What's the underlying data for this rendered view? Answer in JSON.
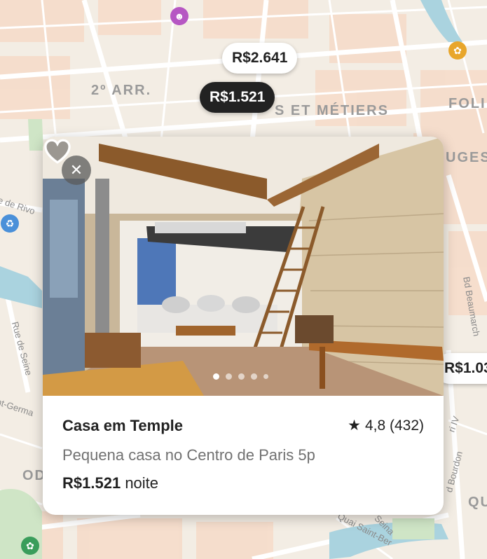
{
  "map": {
    "labels": {
      "arrondissement": "2º ARR.",
      "arts_metiers": "S ET MÉTIERS",
      "folie": "FOLI",
      "uges": "UGES",
      "od": "OD",
      "qu": "QU"
    },
    "streets": {
      "rue_de_rivoli": "e de Rivo",
      "rue_de_seine": "Rue de Seine",
      "bd_beaumarchais": "Bd Beaumarch",
      "rue_bourdon": "d Bourdon",
      "saint_germain": "nt-Germa",
      "quai_saint_bernard": "Quai Saint-Ber",
      "seine": "Seina",
      "henri_iv": "ri IV"
    },
    "pins": {
      "pin_top": "R$2.641",
      "pin_selected": "R$1.521",
      "pin_right": "R$1.03"
    },
    "poi_icons": [
      "theater-icon",
      "park-icon",
      "trash-icon",
      "garden-icon"
    ]
  },
  "listing": {
    "title": "Casa em Temple",
    "rating": "4,8 (432)",
    "subtitle": "Pequena casa no Centro de Paris 5p",
    "price": "R$1.521",
    "price_unit": "noite",
    "photo_count": 5,
    "active_photo": 1
  },
  "colors": {
    "brand_dark": "#222222",
    "muted_text": "#717171",
    "map_bg": "#f2efe9",
    "water": "#aad3df"
  }
}
